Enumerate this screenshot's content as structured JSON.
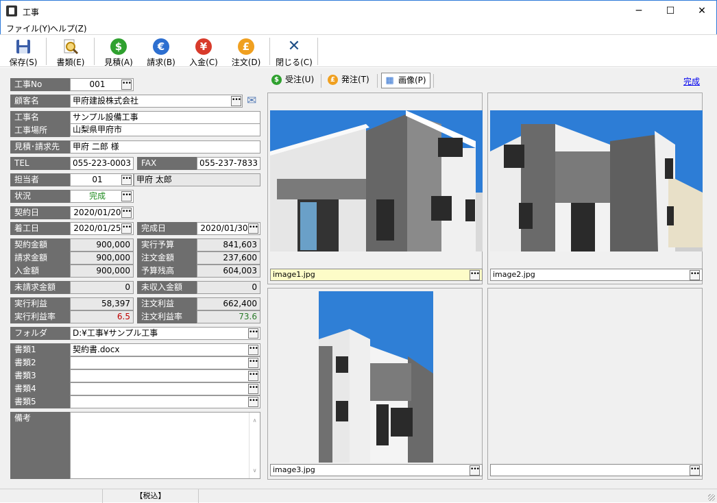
{
  "window": {
    "title": "工事",
    "minimize": "─",
    "maximize": "☐",
    "close": "✕"
  },
  "menu": [
    "ファイル(Y)",
    "ヘルプ(Z)"
  ],
  "toolbar": {
    "save": "保存(S)",
    "docs": "書類(E)",
    "estimate": "見積(A)",
    "invoice": "請求(B)",
    "deposit": "入金(C)",
    "order": "注文(D)",
    "close": "閉じる(C)"
  },
  "toolbar_icons": {
    "estimate_glyph": "$",
    "invoice_glyph": "€",
    "deposit_glyph": "¥",
    "order_glyph": "£",
    "close_glyph": "✕",
    "estimate_color": "#2fa12f",
    "invoice_color": "#2d6fd0",
    "deposit_color": "#d83b2b",
    "order_color": "#f0a020",
    "close_color": "#1f4f86"
  },
  "form": {
    "no_label": "工事No",
    "no_value": "001",
    "customer_label": "顧客名",
    "customer_value": "甲府建設株式会社",
    "name_label": "工事名",
    "name_value": "サンプル設備工事",
    "place_label": "工事場所",
    "place_value": "山梨県甲府市",
    "billto_label": "見積･請求先",
    "billto_value": "甲府 二郎 様",
    "tel_label": "TEL",
    "tel_value": "055-223-0003",
    "fax_label": "FAX",
    "fax_value": "055-237-7833",
    "staff_label": "担当者",
    "staff_code": "01",
    "staff_name": "甲府 太郎",
    "status_label": "状況",
    "status_value": "完成",
    "contract_date_label": "契約日",
    "contract_date": "2020/01/20",
    "start_label": "着工日",
    "start_date": "2020/01/25",
    "finish_label": "完成日",
    "finish_date": "2020/01/30",
    "contract_amt_label": "契約金額",
    "contract_amt": "900,000",
    "exec_budget_label": "実行予算",
    "exec_budget": "841,603",
    "billed_label": "請求金額",
    "billed": "900,000",
    "order_amt_label": "注文金額",
    "order_amt": "237,600",
    "paid_label": "入金額",
    "paid": "900,000",
    "budget_rem_label": "予算残高",
    "budget_rem": "604,003",
    "unbilled_label": "未請求金額",
    "unbilled": "0",
    "uncollected_label": "未収入金額",
    "uncollected": "0",
    "exec_profit_label": "実行利益",
    "exec_profit": "58,397",
    "order_profit_label": "注文利益",
    "order_profit": "662,400",
    "exec_rate_label": "実行利益率",
    "exec_rate": "6.5",
    "order_rate_label": "注文利益率",
    "order_rate": "73.6",
    "folder_label": "フォルダ",
    "folder_value": "D:¥工事¥サンプル工事",
    "doc1_label": "書類1",
    "doc1_value": "契約書.docx",
    "doc2_label": "書類2",
    "doc3_label": "書類3",
    "doc4_label": "書類4",
    "doc5_label": "書類5",
    "memo_label": "備考",
    "ellipsis": "•••",
    "mail_glyph": "✉"
  },
  "colors": {
    "rate_negative": "#c00000",
    "rate_positive": "#2a7a2a",
    "status_green": "#1f8a1f"
  },
  "tabs": {
    "received": "受注(U)",
    "placed": "発注(T)",
    "images": "画像(P)",
    "received_glyph": "$",
    "placed_glyph": "£",
    "images_glyph": "▦",
    "complete_link": "完成"
  },
  "images": {
    "img1": "image1.jpg",
    "img2": "image2.jpg",
    "img3": "image3.jpg",
    "img4": ""
  },
  "statusbar": {
    "tax": "【税込】"
  }
}
